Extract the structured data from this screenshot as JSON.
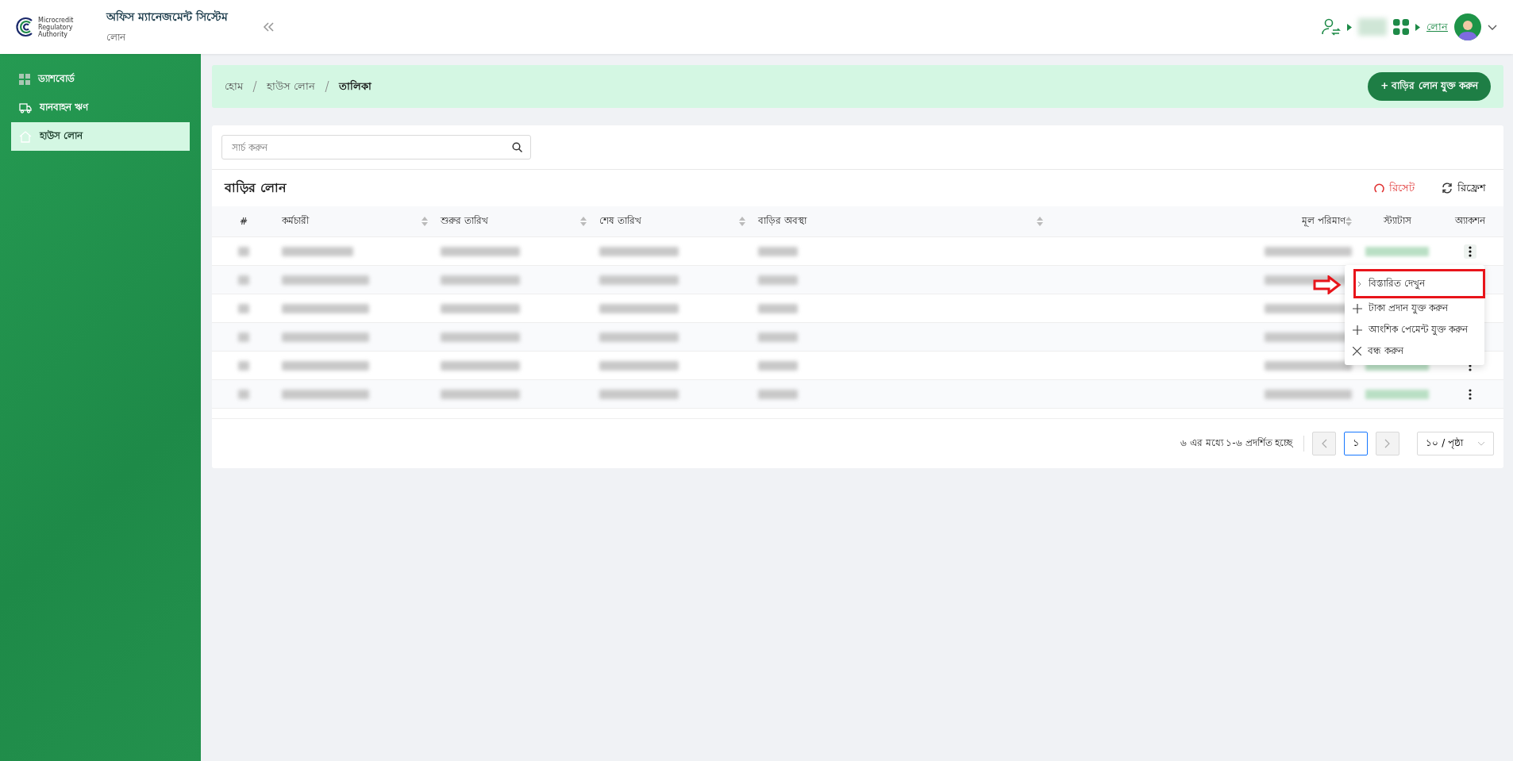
{
  "header": {
    "logo_text": [
      "Microcredit",
      "Regulatory",
      "Authority"
    ],
    "app_title": "অফিস ম্যানেজমেন্ট সিস্টেম",
    "app_subtitle": "লোন",
    "module_link": "লোন"
  },
  "sidebar": {
    "items": [
      {
        "label": "ড্যাশবোর্ড",
        "kind": "dashboard",
        "selected": false
      },
      {
        "label": "যানবাহন ঋণ",
        "kind": "vehicle",
        "selected": false
      },
      {
        "label": "হাউস লোন",
        "kind": "house",
        "selected": true
      }
    ]
  },
  "breadcrumb": [
    {
      "label": "হোম",
      "current": false
    },
    {
      "label": "হাউস লোন",
      "current": false
    },
    {
      "label": "তালিকা",
      "current": true
    }
  ],
  "add_button": "+ বাড়ির লোন যুক্ত করুন",
  "search": {
    "placeholder": "সার্চ করুন"
  },
  "table": {
    "title": "বাড়ির লোন",
    "reset": "রিসেট",
    "refresh": "রিফ্রেশ",
    "columns": [
      {
        "label": "#",
        "sortable": false
      },
      {
        "label": "কর্মচারী",
        "sortable": true
      },
      {
        "label": "শুরুর তারিখ",
        "sortable": true
      },
      {
        "label": "শেষ তারিখ",
        "sortable": true
      },
      {
        "label": "বাড়ির অবস্থা",
        "sortable": true
      },
      {
        "label": "মূল পরিমাণ",
        "sortable": true
      },
      {
        "label": "স্ট্যাটাস",
        "sortable": false
      },
      {
        "label": "অ্যাকশন",
        "sortable": false
      }
    ],
    "rows": [
      {
        "menu_open": true
      },
      {},
      {},
      {},
      {},
      {}
    ]
  },
  "action_menu": [
    {
      "label": "বিস্তারিত দেখুন",
      "kind": "view",
      "highlighted": true
    },
    {
      "label": "টাকা প্রদান যুক্ত করুন",
      "kind": "add",
      "highlighted": false
    },
    {
      "label": "আংশিক পেমেন্ট যুক্ত করুন",
      "kind": "add",
      "highlighted": false
    },
    {
      "label": "বন্ধ করুন",
      "kind": "close",
      "highlighted": false
    }
  ],
  "pagination": {
    "summary": "৬ এর মধ্যে ১-৬ প্রদর্শিত হচ্ছে",
    "pages": [
      {
        "label": "১",
        "selected": true
      }
    ],
    "page_size": "১০ / পৃষ্ঠা"
  }
}
